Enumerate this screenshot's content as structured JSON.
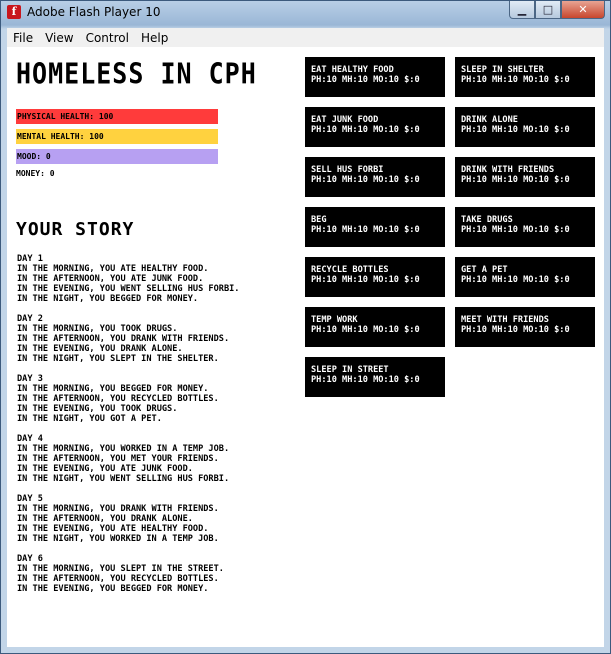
{
  "window": {
    "title": "Adobe Flash Player 10",
    "icon": "f"
  },
  "menu": [
    "File",
    "View",
    "Control",
    "Help"
  ],
  "game": {
    "title": "Homeless in CPH",
    "stats": [
      {
        "label": "Physical health: 100",
        "color": "#ff3b3b"
      },
      {
        "label": "Mental health: 100",
        "color": "#ffd23f"
      },
      {
        "label": "Mood: 0",
        "color": "#b7a0f2"
      }
    ],
    "money": "Money: 0",
    "story_title": "Your Story",
    "story": [
      [
        "Day 1",
        "In the morning, you ate healthy food.",
        "In the afternoon, you ate junk food.",
        "In the evening, you went selling Hus Forbi.",
        "In the night, you begged for money."
      ],
      [
        "Day 2",
        "In the morning, you took drugs.",
        "In the afternoon, you drank with friends.",
        "In the evening, you drank alone.",
        "In the night, you slept in the shelter."
      ],
      [
        "Day 3",
        "In the morning, you begged for money.",
        "In the afternoon, you recycled bottles.",
        "In the evening, you took drugs.",
        "In the night, you got a pet."
      ],
      [
        "Day 4",
        "In the morning, you worked in a temp job.",
        "In the afternoon, you met your friends.",
        "In the evening, you ate junk food.",
        "In the night, you went selling Hus Forbi."
      ],
      [
        "Day 5",
        "In the morning, you drank with friends.",
        "In the afternoon, you drank alone.",
        "In the evening, you ate healthy food.",
        "In the night, you worked in a temp job."
      ],
      [
        "Day 6",
        "In the morning, you slept in the street.",
        "In the afternoon, you recycled bottles.",
        "In the evening, you begged for money."
      ]
    ],
    "actions_left": [
      {
        "name": "Eat healthy food",
        "stats": "PH:10 MH:10 MO:10 $:0"
      },
      {
        "name": "Eat junk food",
        "stats": "PH:10 MH:10 MO:10 $:0"
      },
      {
        "name": "Sell Hus Forbi",
        "stats": "PH:10 MH:10 MO:10 $:0"
      },
      {
        "name": "Beg",
        "stats": "PH:10 MH:10 MO:10 $:0"
      },
      {
        "name": "Recycle bottles",
        "stats": "PH:10 MH:10 MO:10 $:0"
      },
      {
        "name": "Temp work",
        "stats": "PH:10 MH:10 MO:10 $:0"
      },
      {
        "name": "Sleep in street",
        "stats": "PH:10 MH:10 MO:10 $:0"
      }
    ],
    "actions_right": [
      {
        "name": "Sleep in shelter",
        "stats": "PH:10 MH:10 MO:10 $:0"
      },
      {
        "name": "Drink alone",
        "stats": "PH:10 MH:10 MO:10 $:0"
      },
      {
        "name": "Drink with friends",
        "stats": "PH:10 MH:10 MO:10 $:0"
      },
      {
        "name": "Take drugs",
        "stats": "PH:10 MH:10 MO:10 $:0"
      },
      {
        "name": "Get a pet",
        "stats": "PH:10 MH:10 MO:10 $:0"
      },
      {
        "name": "Meet with friends",
        "stats": "PH:10 MH:10 MO:10 $:0"
      }
    ]
  }
}
